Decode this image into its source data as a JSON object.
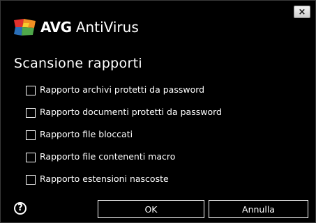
{
  "window": {
    "brand": "AVG",
    "product": "AntiVirus",
    "close_label": "×"
  },
  "main": {
    "heading": "Scansione rapporti",
    "options": [
      {
        "label": "Rapporto archivi protetti da password",
        "checked": false
      },
      {
        "label": "Rapporto documenti protetti da password",
        "checked": false
      },
      {
        "label": "Rapporto file bloccati",
        "checked": false
      },
      {
        "label": "Rapporto file contenenti macro",
        "checked": false
      },
      {
        "label": "Rapporto estensioni nascoste",
        "checked": false
      }
    ]
  },
  "footer": {
    "help_icon": "?",
    "ok_label": "OK",
    "cancel_label": "Annulla"
  },
  "colors": {
    "background": "#000000",
    "text": "#ffffff",
    "logo_red": "#e2312d",
    "logo_orange": "#f29023",
    "logo_yellow": "#f7cd2e",
    "logo_green": "#4fa84a",
    "logo_blue": "#2a6fb8"
  },
  "icons": {
    "logo": "avg-logo-icon",
    "close": "close-icon",
    "help": "help-icon"
  }
}
